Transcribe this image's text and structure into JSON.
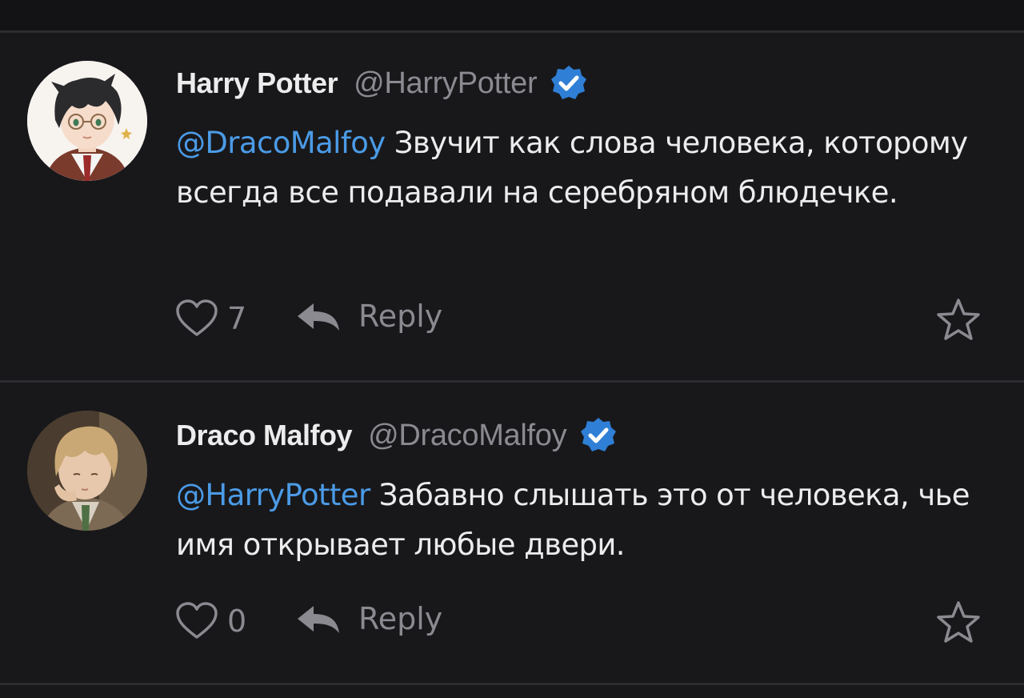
{
  "colors": {
    "background": "#18181b",
    "divider": "#2c2c31",
    "text": "#ececec",
    "muted": "#8a8a90",
    "mention": "#4b9be6",
    "verified": "#2f7fd6"
  },
  "icons": {
    "like": "heart-outline-icon",
    "reply": "reply-arrow-icon",
    "favorite": "star-outline-icon",
    "verified": "verified-badge-icon"
  },
  "comments": [
    {
      "author_name": "Harry Potter",
      "handle": "@HarryPotter",
      "mention": "@DracoMalfoy",
      "text": " Звучит как слова человека, которому всегда все подавали на серебряном блюдечке.",
      "likes": "7",
      "reply_label": "Reply"
    },
    {
      "author_name": "Draco Malfoy",
      "handle": "@DracoMalfoy",
      "mention": "@HarryPotter",
      "text": " Забавно слышать это от человека, чье имя открывает любые двери.",
      "likes": "0",
      "reply_label": "Reply"
    }
  ]
}
